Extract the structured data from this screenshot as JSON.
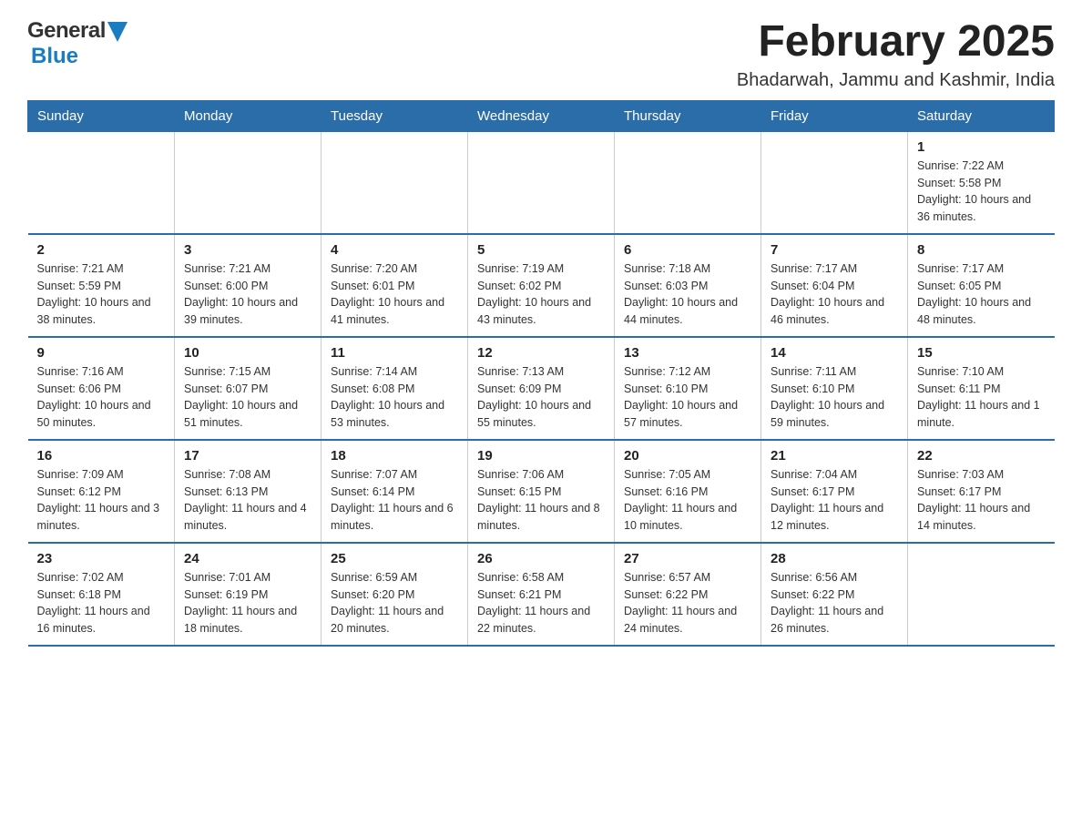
{
  "header": {
    "logo": {
      "general": "General",
      "blue": "Blue"
    },
    "month_title": "February 2025",
    "location": "Bhadarwah, Jammu and Kashmir, India"
  },
  "days_of_week": [
    "Sunday",
    "Monday",
    "Tuesday",
    "Wednesday",
    "Thursday",
    "Friday",
    "Saturday"
  ],
  "weeks": [
    [
      {
        "day": "",
        "info": ""
      },
      {
        "day": "",
        "info": ""
      },
      {
        "day": "",
        "info": ""
      },
      {
        "day": "",
        "info": ""
      },
      {
        "day": "",
        "info": ""
      },
      {
        "day": "",
        "info": ""
      },
      {
        "day": "1",
        "info": "Sunrise: 7:22 AM\nSunset: 5:58 PM\nDaylight: 10 hours and 36 minutes."
      }
    ],
    [
      {
        "day": "2",
        "info": "Sunrise: 7:21 AM\nSunset: 5:59 PM\nDaylight: 10 hours and 38 minutes."
      },
      {
        "day": "3",
        "info": "Sunrise: 7:21 AM\nSunset: 6:00 PM\nDaylight: 10 hours and 39 minutes."
      },
      {
        "day": "4",
        "info": "Sunrise: 7:20 AM\nSunset: 6:01 PM\nDaylight: 10 hours and 41 minutes."
      },
      {
        "day": "5",
        "info": "Sunrise: 7:19 AM\nSunset: 6:02 PM\nDaylight: 10 hours and 43 minutes."
      },
      {
        "day": "6",
        "info": "Sunrise: 7:18 AM\nSunset: 6:03 PM\nDaylight: 10 hours and 44 minutes."
      },
      {
        "day": "7",
        "info": "Sunrise: 7:17 AM\nSunset: 6:04 PM\nDaylight: 10 hours and 46 minutes."
      },
      {
        "day": "8",
        "info": "Sunrise: 7:17 AM\nSunset: 6:05 PM\nDaylight: 10 hours and 48 minutes."
      }
    ],
    [
      {
        "day": "9",
        "info": "Sunrise: 7:16 AM\nSunset: 6:06 PM\nDaylight: 10 hours and 50 minutes."
      },
      {
        "day": "10",
        "info": "Sunrise: 7:15 AM\nSunset: 6:07 PM\nDaylight: 10 hours and 51 minutes."
      },
      {
        "day": "11",
        "info": "Sunrise: 7:14 AM\nSunset: 6:08 PM\nDaylight: 10 hours and 53 minutes."
      },
      {
        "day": "12",
        "info": "Sunrise: 7:13 AM\nSunset: 6:09 PM\nDaylight: 10 hours and 55 minutes."
      },
      {
        "day": "13",
        "info": "Sunrise: 7:12 AM\nSunset: 6:10 PM\nDaylight: 10 hours and 57 minutes."
      },
      {
        "day": "14",
        "info": "Sunrise: 7:11 AM\nSunset: 6:10 PM\nDaylight: 10 hours and 59 minutes."
      },
      {
        "day": "15",
        "info": "Sunrise: 7:10 AM\nSunset: 6:11 PM\nDaylight: 11 hours and 1 minute."
      }
    ],
    [
      {
        "day": "16",
        "info": "Sunrise: 7:09 AM\nSunset: 6:12 PM\nDaylight: 11 hours and 3 minutes."
      },
      {
        "day": "17",
        "info": "Sunrise: 7:08 AM\nSunset: 6:13 PM\nDaylight: 11 hours and 4 minutes."
      },
      {
        "day": "18",
        "info": "Sunrise: 7:07 AM\nSunset: 6:14 PM\nDaylight: 11 hours and 6 minutes."
      },
      {
        "day": "19",
        "info": "Sunrise: 7:06 AM\nSunset: 6:15 PM\nDaylight: 11 hours and 8 minutes."
      },
      {
        "day": "20",
        "info": "Sunrise: 7:05 AM\nSunset: 6:16 PM\nDaylight: 11 hours and 10 minutes."
      },
      {
        "day": "21",
        "info": "Sunrise: 7:04 AM\nSunset: 6:17 PM\nDaylight: 11 hours and 12 minutes."
      },
      {
        "day": "22",
        "info": "Sunrise: 7:03 AM\nSunset: 6:17 PM\nDaylight: 11 hours and 14 minutes."
      }
    ],
    [
      {
        "day": "23",
        "info": "Sunrise: 7:02 AM\nSunset: 6:18 PM\nDaylight: 11 hours and 16 minutes."
      },
      {
        "day": "24",
        "info": "Sunrise: 7:01 AM\nSunset: 6:19 PM\nDaylight: 11 hours and 18 minutes."
      },
      {
        "day": "25",
        "info": "Sunrise: 6:59 AM\nSunset: 6:20 PM\nDaylight: 11 hours and 20 minutes."
      },
      {
        "day": "26",
        "info": "Sunrise: 6:58 AM\nSunset: 6:21 PM\nDaylight: 11 hours and 22 minutes."
      },
      {
        "day": "27",
        "info": "Sunrise: 6:57 AM\nSunset: 6:22 PM\nDaylight: 11 hours and 24 minutes."
      },
      {
        "day": "28",
        "info": "Sunrise: 6:56 AM\nSunset: 6:22 PM\nDaylight: 11 hours and 26 minutes."
      },
      {
        "day": "",
        "info": ""
      }
    ]
  ]
}
